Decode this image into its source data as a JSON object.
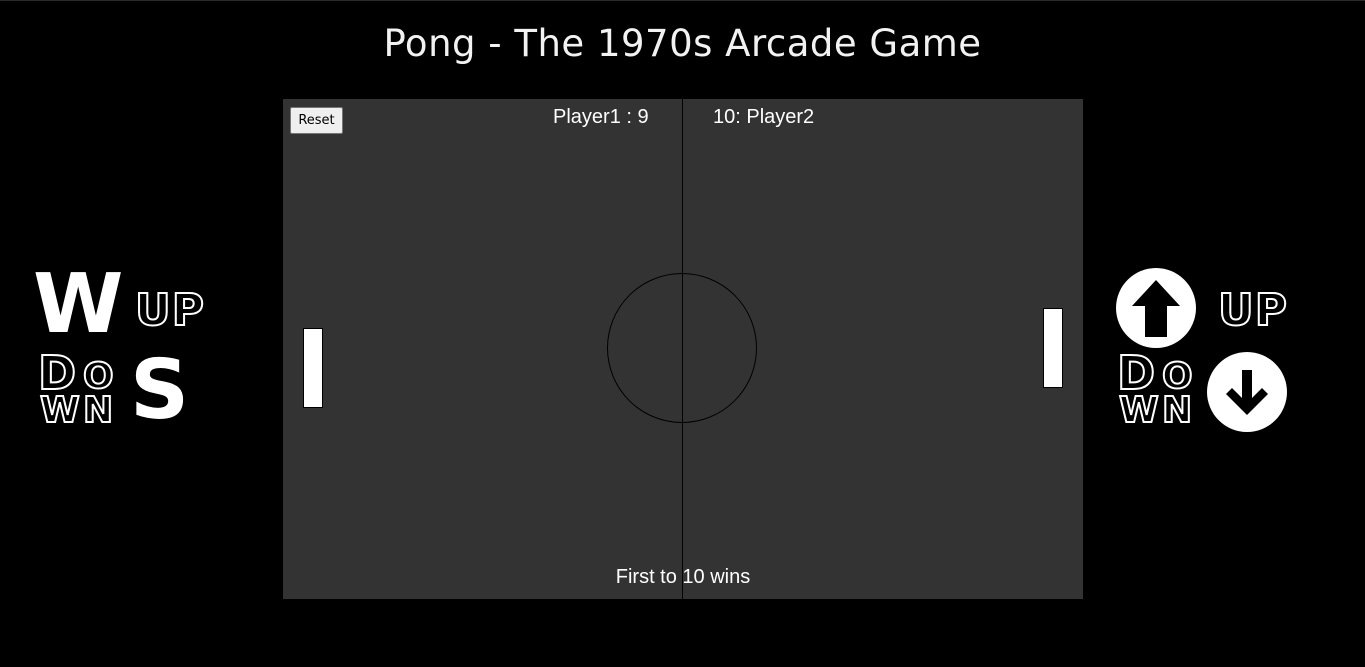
{
  "page": {
    "title": "Pong - The 1970s Arcade Game"
  },
  "game": {
    "reset_label": "Reset",
    "score_left": "Player1 : 9",
    "score_right": "10: Player2",
    "footer": "First to 10 wins",
    "player1_score": 9,
    "player2_score": 10,
    "winning_score": 10
  },
  "controls": {
    "left": {
      "up_key": "W",
      "down_key": "S",
      "up_label": "UP",
      "down_label_parts": [
        "D",
        "O",
        "W",
        "N"
      ]
    },
    "right": {
      "up_icon": "arrow-up-circle-icon",
      "down_icon": "arrow-down-circle-icon",
      "up_label": "UP",
      "down_label_parts": [
        "D",
        "O",
        "W",
        "N"
      ]
    }
  },
  "colors": {
    "background": "#000000",
    "court": "#333333",
    "paddle": "#ffffff",
    "text": "#ffffff"
  }
}
